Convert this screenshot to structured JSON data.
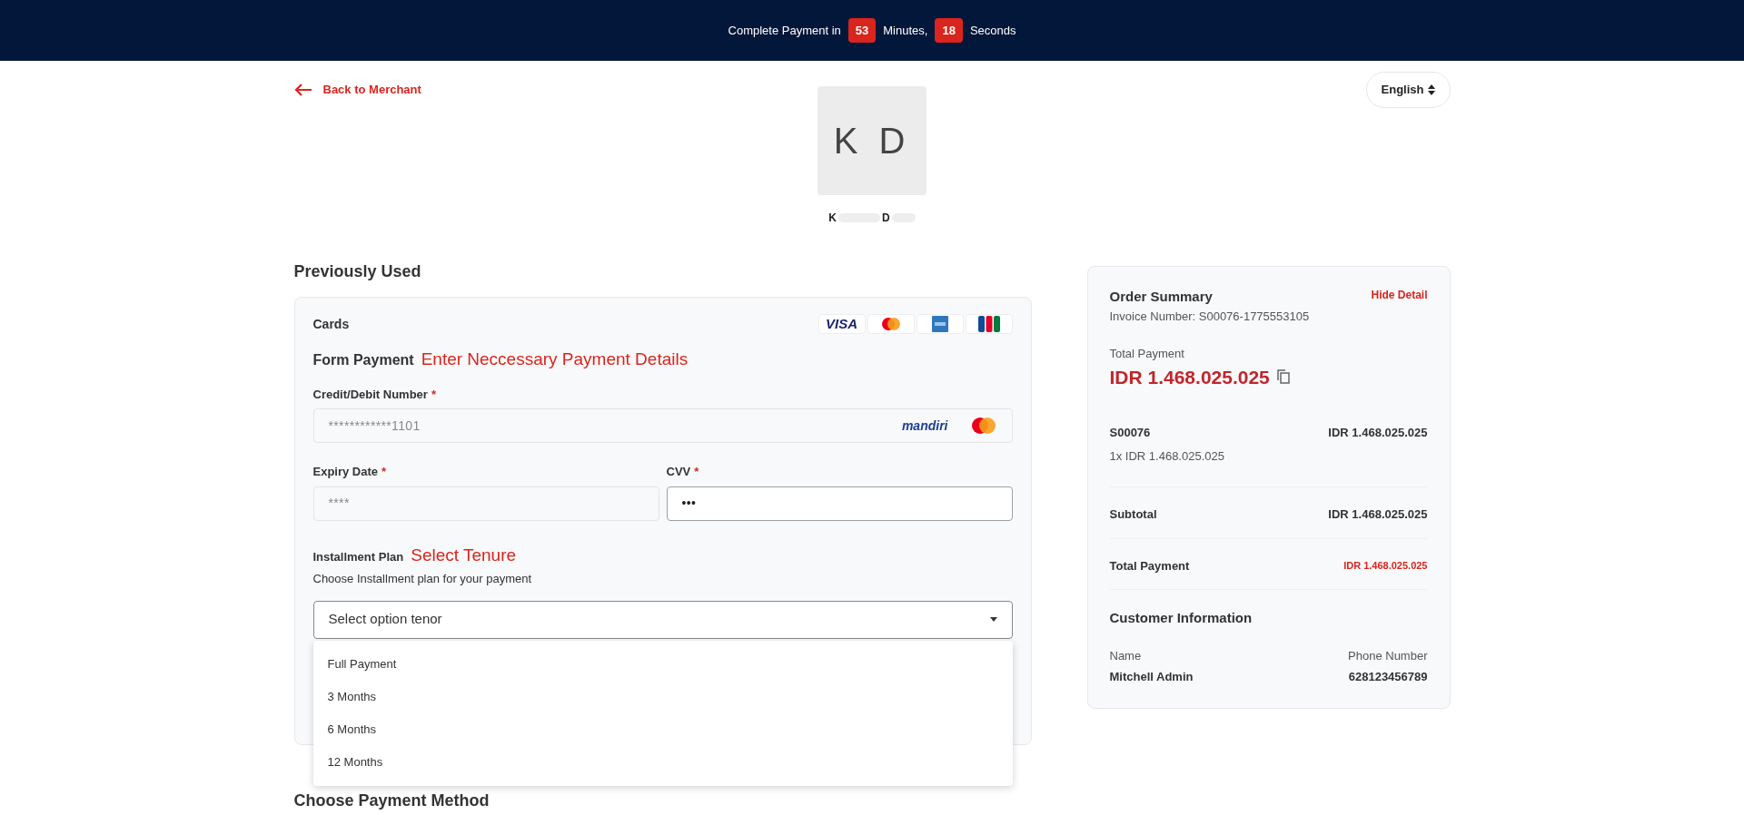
{
  "timer_bar": {
    "prefix": "Complete Payment in",
    "minutes": "53",
    "minutes_label": "Minutes,",
    "seconds": "18",
    "seconds_label": "Seconds"
  },
  "back_link": "Back to Merchant",
  "language": "English",
  "merchant": {
    "initials": "K D",
    "name_parts": [
      "K",
      "D"
    ]
  },
  "previously_used": {
    "heading": "Previously Used",
    "cards": {
      "title": "Cards",
      "brands": [
        {
          "kind": "visa",
          "label": "VISA"
        },
        {
          "kind": "mastercard"
        },
        {
          "kind": "amex"
        },
        {
          "kind": "jcb"
        }
      ]
    },
    "form_title": "Form Payment",
    "form_note": "Enter Neccessary Payment Details",
    "card_number": {
      "label": "Credit/Debit Number",
      "required": "*",
      "value": "************1101",
      "bank": "mandiri",
      "disabled": true
    },
    "expiry": {
      "label": "Expiry Date",
      "required": "*",
      "value": "****",
      "disabled": true
    },
    "cvv": {
      "label": "CVV",
      "required": "*",
      "value": "•••",
      "disabled": false
    },
    "installment": {
      "label": "Installment Plan",
      "note": "Select Tenure",
      "hint": "Choose Installment plan for your payment",
      "placeholder": "Select option tenor",
      "expanded": true,
      "options": [
        {
          "label": "Full Payment",
          "selected": false
        },
        {
          "label": "3 Months",
          "selected": false
        },
        {
          "label": "6 Months",
          "selected": false
        },
        {
          "label": "12 Months",
          "selected": false
        }
      ]
    }
  },
  "payment_method_heading": "Choose Payment Method",
  "order_summary": {
    "title": "Order Summary",
    "toggle": "Hide Detail",
    "invoice": "Invoice Number: S00076-1775553105",
    "total_label": "Total Payment",
    "total": "IDR 1.468.025.025",
    "items": [
      {
        "name": "S00076",
        "qty_price": "1x IDR 1.468.025.025",
        "amount": "IDR 1.468.025.025"
      }
    ],
    "subtotal_label": "Subtotal",
    "subtotal": "IDR 1.468.025.025",
    "grand_label": "Total Payment",
    "grand_total": "IDR 1.468.025.025"
  },
  "customer": {
    "title": "Customer Information",
    "name_label": "Name",
    "name": "Mitchell Admin",
    "phone_label": "Phone Number",
    "phone": "628123456789"
  }
}
